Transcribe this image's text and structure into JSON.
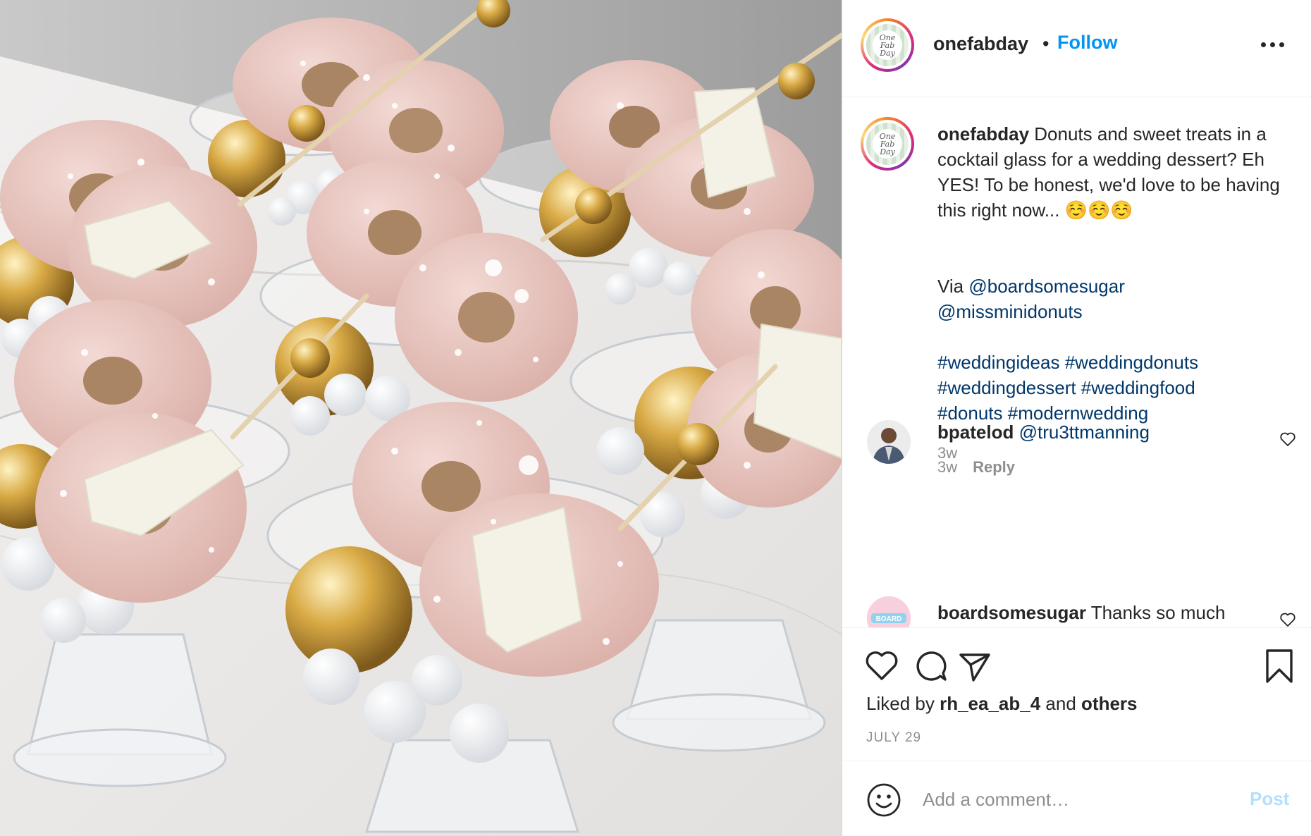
{
  "post": {
    "image_alt": "Donuts in cocktail glasses",
    "header": {
      "username": "onefabday",
      "separator": "•",
      "follow_label": "Follow",
      "avatar_text": "One Fab Day",
      "more_icon": "more-horizontal-icon"
    },
    "caption": {
      "username": "onefabday",
      "text": "Donuts and sweet treats in a cocktail glass for a wedding dessert? Eh YES! To be honest, we'd love to be having this right now... ☺️☺️☺️",
      "via_label": "Via",
      "mention_1": "@boardsomesugar",
      "mention_2": "@missminidonuts",
      "hashtags_line_1": "#weddingideas #weddingdonuts",
      "hashtags_line_2": "#weddingdessert #weddingfood",
      "hashtags_line_3": "#donuts #modernwedding",
      "time": "3w"
    },
    "comments": [
      {
        "username": "bpatelod",
        "mention": "@tru3ttmanning",
        "time": "3w",
        "reply_label": "Reply"
      },
      {
        "username": "boardsomesugar",
        "text": "Thanks so much",
        "avatar_text": "BOARD"
      }
    ],
    "actions": {
      "like_icon": "heart-icon",
      "comment_icon": "comment-icon",
      "share_icon": "send-icon",
      "save_icon": "bookmark-icon"
    },
    "likes": {
      "prefix": "Liked by",
      "user": "rh_ea_ab_4",
      "middle": "and",
      "suffix": "others"
    },
    "date": "JULY 29",
    "add_comment": {
      "emoji_icon": "smiley-icon",
      "placeholder": "Add a comment…",
      "post_label": "Post"
    },
    "colors": {
      "link_blue": "#0095f6",
      "link_dark": "#00376b",
      "muted": "#8e8e8e",
      "post_disabled": "#b2dffc"
    }
  }
}
